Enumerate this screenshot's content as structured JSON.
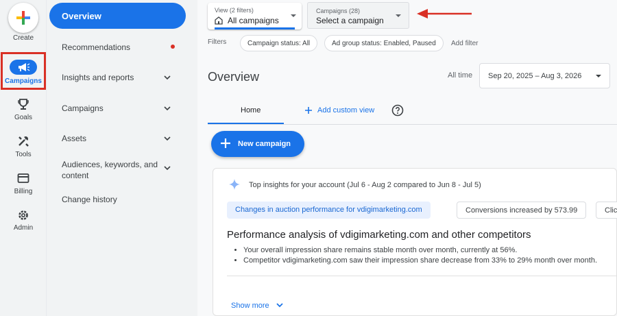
{
  "rail": {
    "create_label": "Create",
    "campaigns_label": "Campaigns",
    "goals_label": "Goals",
    "tools_label": "Tools",
    "billing_label": "Billing",
    "admin_label": "Admin"
  },
  "nav": {
    "overview": "Overview",
    "recommendations": "Recommendations",
    "insights": "Insights and reports",
    "campaigns": "Campaigns",
    "assets": "Assets",
    "audiences_line1": "Audiences, keywords, and",
    "audiences_line2": "content",
    "change_history": "Change history"
  },
  "toolbar": {
    "view_small": "View (2 filters)",
    "view_main": "All campaigns",
    "campaigns_small": "Campaigns (28)",
    "campaigns_main": "Select a campaign"
  },
  "filters": {
    "label": "Filters",
    "chips": [
      "Campaign status: All",
      "Ad group status: Enabled, Paused"
    ],
    "add_filter": "Add filter"
  },
  "header": {
    "title": "Overview",
    "all_time": "All time",
    "date_range": "Sep 20, 2025 – Aug 3, 2026"
  },
  "tabs": {
    "home": "Home",
    "add_custom_view": "Add custom view"
  },
  "new_campaign": "New campaign",
  "insights_card": {
    "heading": "Top insights for your account (Jul 6 - Aug 2 compared to Jun 8 - Jul 5)",
    "chips": [
      "Changes in auction performance for vdigimarketing.com",
      "Conversions increased by 573.99",
      "Clic"
    ],
    "title": "Performance analysis of vdigimarketing.com and other competitors",
    "bullets": [
      "Your overall impression share remains stable month over month, currently at 56%.",
      "Competitor vdigimarketing.com saw their impression share decrease from 33% to 29% month over month."
    ],
    "show_more": "Show more"
  },
  "colors": {
    "accent": "#1a73e8",
    "highlight_box": "#d93025",
    "annotation_arrow": "#d93025"
  }
}
